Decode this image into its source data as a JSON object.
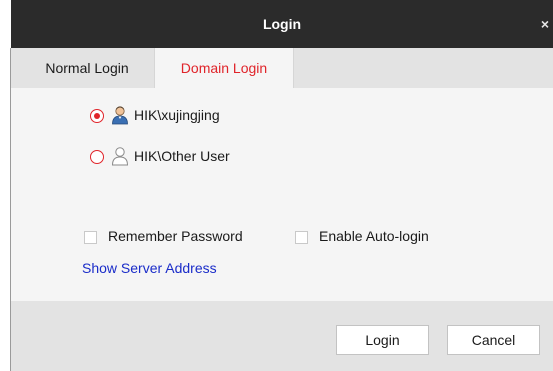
{
  "window": {
    "title": "Login",
    "close_glyph": "×"
  },
  "tabs": [
    {
      "label": "Normal Login",
      "active": false
    },
    {
      "label": "Domain Login",
      "active": true
    }
  ],
  "accounts": [
    {
      "label": "HIK\\xujingjing",
      "selected": true,
      "icon": "user-icon"
    },
    {
      "label": "HIK\\Other User",
      "selected": false,
      "icon": "user-outline-icon"
    }
  ],
  "options": {
    "remember_password": {
      "label": "Remember Password",
      "checked": false
    },
    "auto_login": {
      "label": "Enable Auto-login",
      "checked": false
    }
  },
  "link": {
    "show_server": "Show Server Address"
  },
  "buttons": {
    "login": "Login",
    "cancel": "Cancel"
  },
  "colors": {
    "accent": "#e0242a",
    "titlebar": "#2b2b2b",
    "link": "#1a2cc9"
  }
}
